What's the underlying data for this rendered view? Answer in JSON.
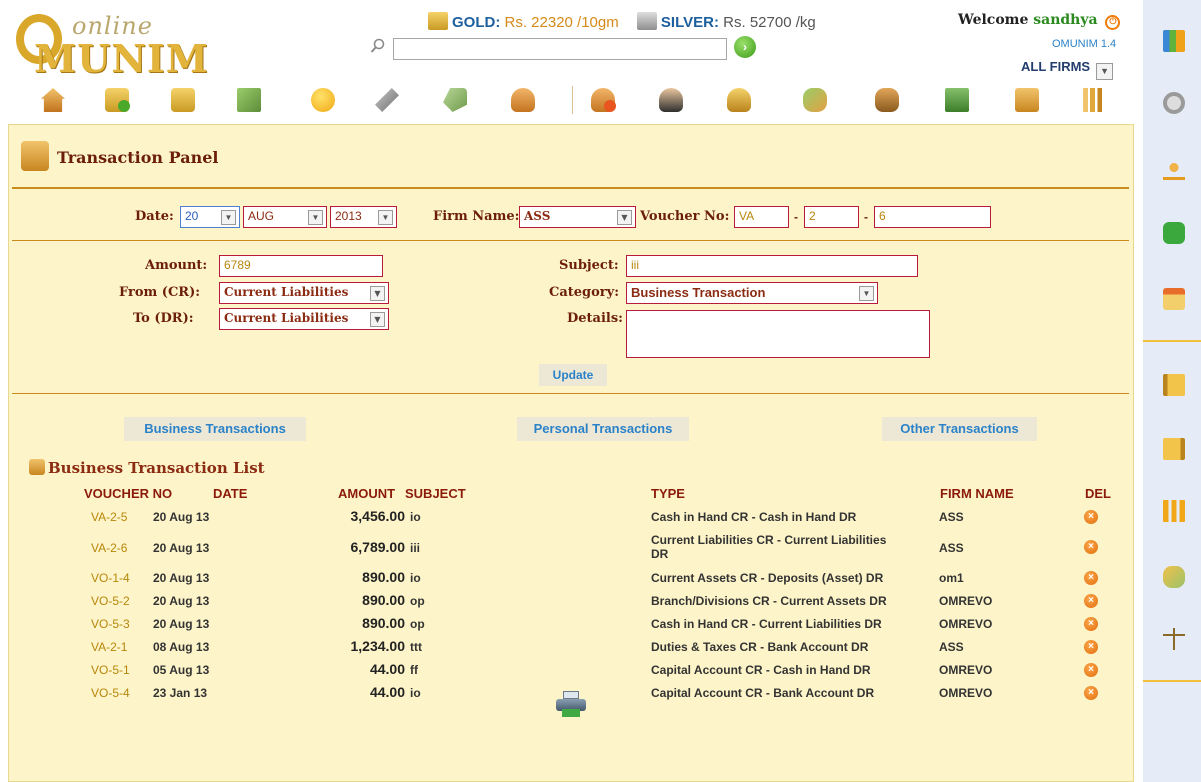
{
  "header": {
    "logo_online": "online",
    "logo_munim": "MUNIM",
    "gold_label": "GOLD:",
    "gold_value": "Rs. 22320 /10gm",
    "silver_label": "SILVER:",
    "silver_value": "Rs. 52700 /kg",
    "welcome_label": "Welcome",
    "username": "sandhya",
    "version": "OMUNIM 1.4",
    "firm_filter": "ALL FIRMS",
    "search_value": ""
  },
  "toolbar_icons": [
    "home-icon",
    "add-gold-icon",
    "gold-stock-icon",
    "repair-icon",
    "new-badge-icon",
    "tools-icon",
    "tag-icon",
    "user-icon",
    "add-user-icon",
    "girvi-user-icon",
    "staff-icon",
    "group-icon",
    "money-bag-icon",
    "cash-icon",
    "transaction-icon",
    "report-chart-icon"
  ],
  "panel": {
    "title": "Transaction Panel",
    "date_label": "Date:",
    "day": "20",
    "month": "AUG",
    "year": "2013",
    "firm_label": "Firm Name:",
    "firm_value": "ASS",
    "voucher_label": "Voucher No:",
    "voucher_prefix": "VA",
    "voucher_series": "2",
    "voucher_number": "6",
    "amount_label": "Amount:",
    "amount_value": "6789",
    "from_label": "From (CR):",
    "from_value": "Current Liabilities",
    "to_label": "To (DR):",
    "to_value": "Current Liabilities",
    "subject_label": "Subject:",
    "subject_value": "iii",
    "category_label": "Category:",
    "category_value": "Business Transaction",
    "details_label": "Details:",
    "details_value": "",
    "update_label": "Update"
  },
  "tabs": {
    "business": "Business Transactions",
    "personal": "Personal Transactions",
    "other": "Other Transactions"
  },
  "list": {
    "title": "Business Transaction List",
    "columns": {
      "voucher": "VOUCHER NO",
      "date": "DATE",
      "amount": "AMOUNT",
      "subject": "SUBJECT",
      "type": "TYPE",
      "firm": "FIRM NAME",
      "del": "DEL"
    },
    "rows": [
      {
        "voucher": "VA-2-5",
        "date": "20 Aug 13",
        "amount": "3,456.00",
        "subject": "io",
        "type": "Cash in Hand CR - Cash in Hand DR",
        "firm": "ASS"
      },
      {
        "voucher": "VA-2-6",
        "date": "20 Aug 13",
        "amount": "6,789.00",
        "subject": "iii",
        "type": "Current Liabilities CR - Current Liabilities DR",
        "firm": "ASS"
      },
      {
        "voucher": "VO-1-4",
        "date": "20 Aug 13",
        "amount": "890.00",
        "subject": "io",
        "type": "Current Assets CR - Deposits (Asset) DR",
        "firm": "om1"
      },
      {
        "voucher": "VO-5-2",
        "date": "20 Aug 13",
        "amount": "890.00",
        "subject": "op",
        "type": "Branch/Divisions CR - Current Assets DR",
        "firm": "OMREVO"
      },
      {
        "voucher": "VO-5-3",
        "date": "20 Aug 13",
        "amount": "890.00",
        "subject": "op",
        "type": "Cash in Hand CR - Current Liabilities DR",
        "firm": "OMREVO"
      },
      {
        "voucher": "VA-2-1",
        "date": "08 Aug 13",
        "amount": "1,234.00",
        "subject": "ttt",
        "type": "Duties & Taxes CR - Bank Account DR",
        "firm": "ASS"
      },
      {
        "voucher": "VO-5-1",
        "date": "05 Aug 13",
        "amount": "44.00",
        "subject": "ff",
        "type": "Capital Account CR - Cash in Hand DR",
        "firm": "OMREVO"
      },
      {
        "voucher": "VO-5-4",
        "date": "23 Jan 13",
        "amount": "44.00",
        "subject": "io",
        "type": "Capital Account CR - Bank Account DR",
        "firm": "OMREVO"
      }
    ]
  },
  "sidebar_icons": [
    "dashboard-chart-icon",
    "settings-gear-icon",
    "hierarchy-icon",
    "chat-icon",
    "calendar-icon",
    "ledger-book-icon",
    "journal-book-icon",
    "bar-chart-icon",
    "users-money-icon",
    "balance-scale-icon"
  ]
}
